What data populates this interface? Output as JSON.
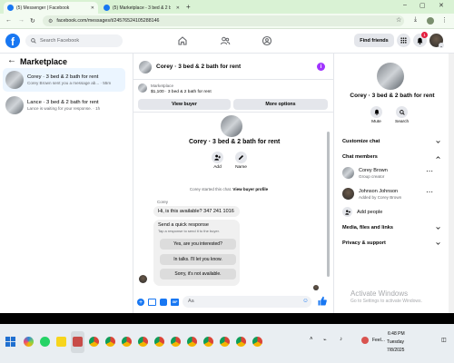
{
  "browser": {
    "tabs": [
      {
        "title": "(5) Messenger | Facebook",
        "active": true
      },
      {
        "title": "(5) Marketplace - 3 bed & 2 ba",
        "active": false
      }
    ],
    "new_tab": "+",
    "url": "facebook.com/messages/t/24576524105288146"
  },
  "header": {
    "logo": "f",
    "search_placeholder": "Search Facebook",
    "find_friends": "Find friends",
    "notification_count": "1"
  },
  "left": {
    "title": "Marketplace",
    "conversations": [
      {
        "title": "Corey · 3 bed & 2 bath for rent",
        "subtitle": "Corey Brown sent you a message ab... · 55m"
      },
      {
        "title": "Lance · 3 bed & 2 bath for rent",
        "subtitle": "Lance is waiting for your response. · 1h"
      }
    ]
  },
  "chat": {
    "title": "Corey · 3 bed & 2 bath for rent",
    "listing_label": "Marketplace",
    "listing_price": "$1,100 · 3 bed & 2 bath for rent",
    "view_buyer": "View buyer",
    "more_options": "More options",
    "profile_title": "Corey · 3 bed & 2 bath for rent",
    "actions": [
      "Add",
      "Name"
    ],
    "system_msg": "Corey started this chat.",
    "system_link": "View buyer profile",
    "sender": "Corey",
    "message": "Hi, is this available? 347 241 1016",
    "quick_title": "Send a quick response",
    "quick_sub": "Tap a response to send it to the buyer.",
    "quick_replies": [
      "Yes, are you interested?",
      "In talks. I'll let you know.",
      "Sorry, it's not available."
    ],
    "composer_placeholder": "Aa"
  },
  "right": {
    "title": "Corey · 3 bed & 2 bath for rent",
    "actions": [
      "Mute",
      "Search"
    ],
    "customize": "Customize chat",
    "members_title": "Chat members",
    "members": [
      {
        "name": "Corey Brown",
        "role": "Group creator"
      },
      {
        "name": "Johnson Johnson",
        "role": "Added by Corey Brown"
      }
    ],
    "add_people": "Add people",
    "media": "Media, files and links",
    "privacy": "Privacy & support",
    "watermark_title": "Activate Windows",
    "watermark_sub": "Go to Settings to activate Windows."
  },
  "taskbar": {
    "time": "6:48 PM",
    "day": "Tuesday",
    "date": "7/8/2025",
    "weather": "Feel..."
  },
  "colors": {
    "accent": "#1877f2",
    "chrome": "#d9f2d4",
    "purple": "#a033ff"
  }
}
